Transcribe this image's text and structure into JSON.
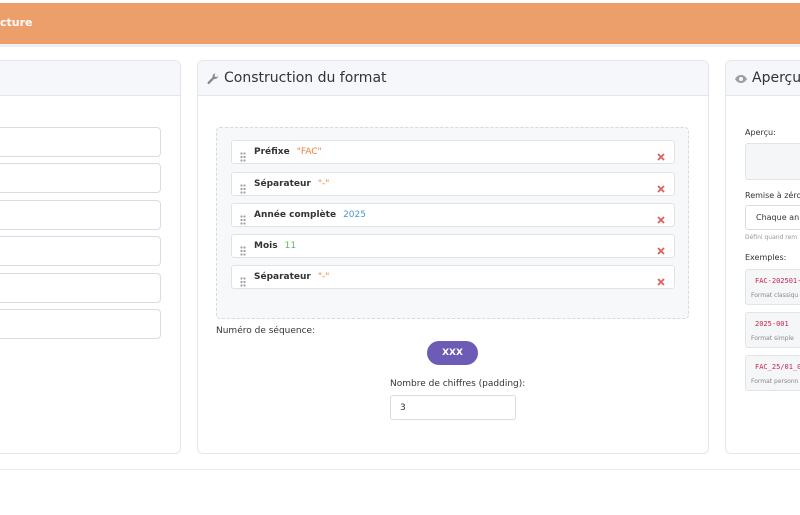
{
  "header": {
    "title": "cture",
    "color": "#ec9e6b"
  },
  "middle": {
    "title": "Construction du format",
    "icon": "wrench-icon",
    "segments": [
      {
        "label": "Préfixe",
        "value": "\"FAC\"",
        "color": "#e8833a"
      },
      {
        "label": "Séparateur",
        "value": "\"-\"",
        "color": "#e8833a"
      },
      {
        "label": "Année complète",
        "value": "2025",
        "color": "#4a9bd0"
      },
      {
        "label": "Mois",
        "value": "11",
        "color": "#5cb85c"
      },
      {
        "label": "Séparateur",
        "value": "\"-\"",
        "color": "#e8833a"
      }
    ],
    "sequence_label": "Numéro de séquence:",
    "sequence_token": "XXX",
    "padding_label": "Nombre de chiffres (padding):",
    "padding_value": "3"
  },
  "right": {
    "title": "Aperçu",
    "icon": "eye-icon",
    "preview_label": "Aperçu:",
    "reset_label": "Remise à zéro",
    "reset_value": "Chaque an",
    "reset_hint": "Défini quand rem",
    "examples_label": "Exemples:",
    "examples": [
      {
        "code": "FAC-202501-",
        "desc": "Format classiqu"
      },
      {
        "code": "2025-001",
        "desc": "Format simple"
      },
      {
        "code": "FAC_25/01_0",
        "desc": "Format personn"
      }
    ]
  }
}
